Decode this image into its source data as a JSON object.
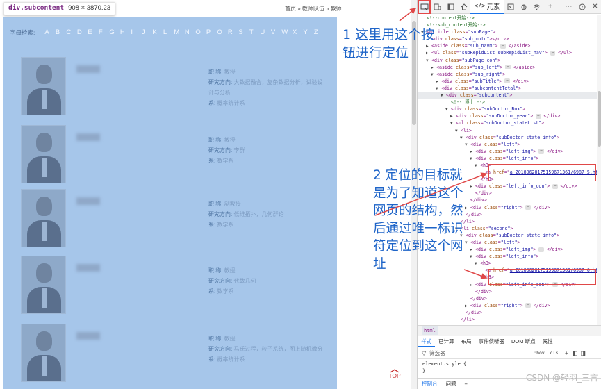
{
  "tooltip": {
    "selector": "div.subcontent",
    "size": "908 × 3870.23"
  },
  "breadcrumb_nav": "首页 » 教师队伍 » 教师",
  "alphabet": {
    "label": "字母检索:",
    "letters": [
      "A",
      "B",
      "C",
      "D",
      "E",
      "F",
      "G",
      "H",
      "I",
      "J",
      "K",
      "L",
      "M",
      "N",
      "O",
      "P",
      "Q",
      "R",
      "S",
      "T",
      "U",
      "V",
      "W",
      "X",
      "Y",
      "Z"
    ]
  },
  "cards": [
    {
      "title_k": "职 称:",
      "title_v": "教授",
      "dir_k": "研究方向:",
      "dir_v": "大数据融合，复杂数据分析，试验设计与分析",
      "dept_k": "系:",
      "dept_v": "概率统计系"
    },
    {
      "title_k": "职 称:",
      "title_v": "教授",
      "dir_k": "研究方向:",
      "dir_v": "李群",
      "dept_k": "系:",
      "dept_v": "数学系"
    },
    {
      "title_k": "职 称:",
      "title_v": "副教授",
      "dir_k": "研究方向:",
      "dir_v": "低维拓扑，几何群论",
      "dept_k": "系:",
      "dept_v": "数学系"
    },
    {
      "title_k": "职 称:",
      "title_v": "教授",
      "dir_k": "研究方向:",
      "dir_v": "代数几何",
      "dept_k": "系:",
      "dept_v": "数学系"
    },
    {
      "title_k": "职 称:",
      "title_v": "教授",
      "dir_k": "研究方向:",
      "dir_v": "马氏过程，粒子系统，图上随机微分",
      "dept_k": "系:",
      "dept_v": "概率统计系"
    }
  ],
  "top_button": "TOP",
  "notes": {
    "note1": "1 这里用这个按钮进行定位",
    "note2": "2 定位的目标就是为了知道这个网页的结构，然后通过唯一标识符定位到这个网址"
  },
  "devtools": {
    "elements_tab": "元素",
    "elements_code": "</>",
    "breadcrumb": "html",
    "style_tabs": [
      "样式",
      "已计算",
      "布局",
      "事件侦听器",
      "DOM 断点",
      "属性"
    ],
    "filter_placeholder": "筛选器",
    "hov_cls": ":hov .cls",
    "element_style": [
      "element.style {",
      "}"
    ],
    "console_tabs": [
      "控制台",
      "问题"
    ],
    "link1": "a_20180628175159671361/6987 5.htm",
    "link2": "a_20180628175159671361/6987 6.htm"
  },
  "watermark": "CSDN @轻羽_三言"
}
